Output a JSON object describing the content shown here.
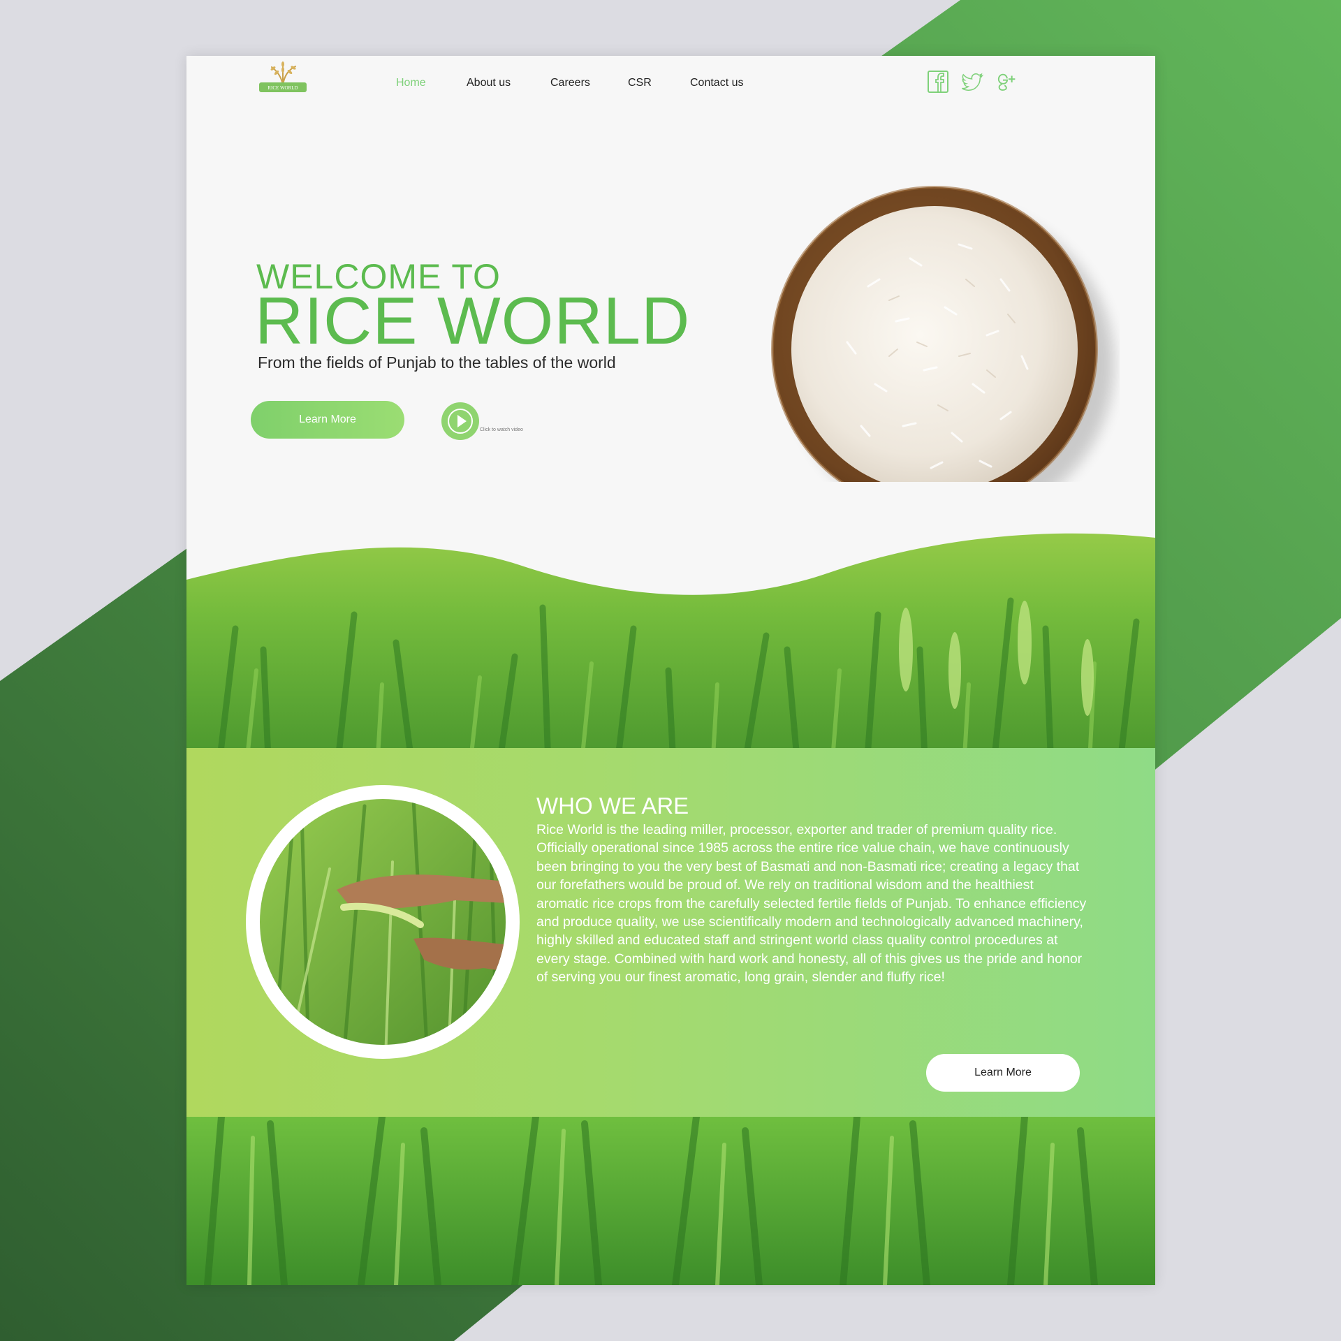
{
  "brand": {
    "logo_text": "RICE WORLD"
  },
  "nav": {
    "items": [
      "Home",
      "About us",
      "Careers",
      "CSR",
      "Contact us"
    ],
    "active": "Home"
  },
  "social": {
    "icons": [
      "facebook-icon",
      "twitter-icon",
      "google-plus-icon"
    ]
  },
  "hero": {
    "welcome": "WELCOME TO",
    "title": "RICE WORLD",
    "subtitle": "From the fields of Punjab to the tables of the world",
    "cta_label": "Learn More",
    "video_label": "Click to watch video"
  },
  "who": {
    "title": "WHO WE ARE",
    "body": "Rice World is the leading miller, processor, exporter and trader of premium quality rice. Officially operational since 1985 across the entire rice value chain, we have continuously been bringing to  you the very best of Basmati and non-Basmati rice; creating a legacy that our forefathers would be proud of. We rely on traditional wisdom and the healthiest aromatic rice crops from the carefully selected fertile fields of Punjab. To  enhance efficiency and produce quality, we use scientifically modern and technologically advanced machinery, highly skilled and educated staff and stringent  world class quality control procedures at every stage. Combined with hard work and honesty, all of this gives us the pride and honor of serving you our finest aromatic, long grain, slender and fluffy rice!",
    "cta_label": "Learn More"
  },
  "colors": {
    "accent": "#5cbb4f",
    "nav_active": "#7fd17a",
    "button_green": "#8fd46f",
    "band_start": "#b0d85e",
    "band_end": "#8fdb86",
    "outer_green": "#4e9a48"
  }
}
